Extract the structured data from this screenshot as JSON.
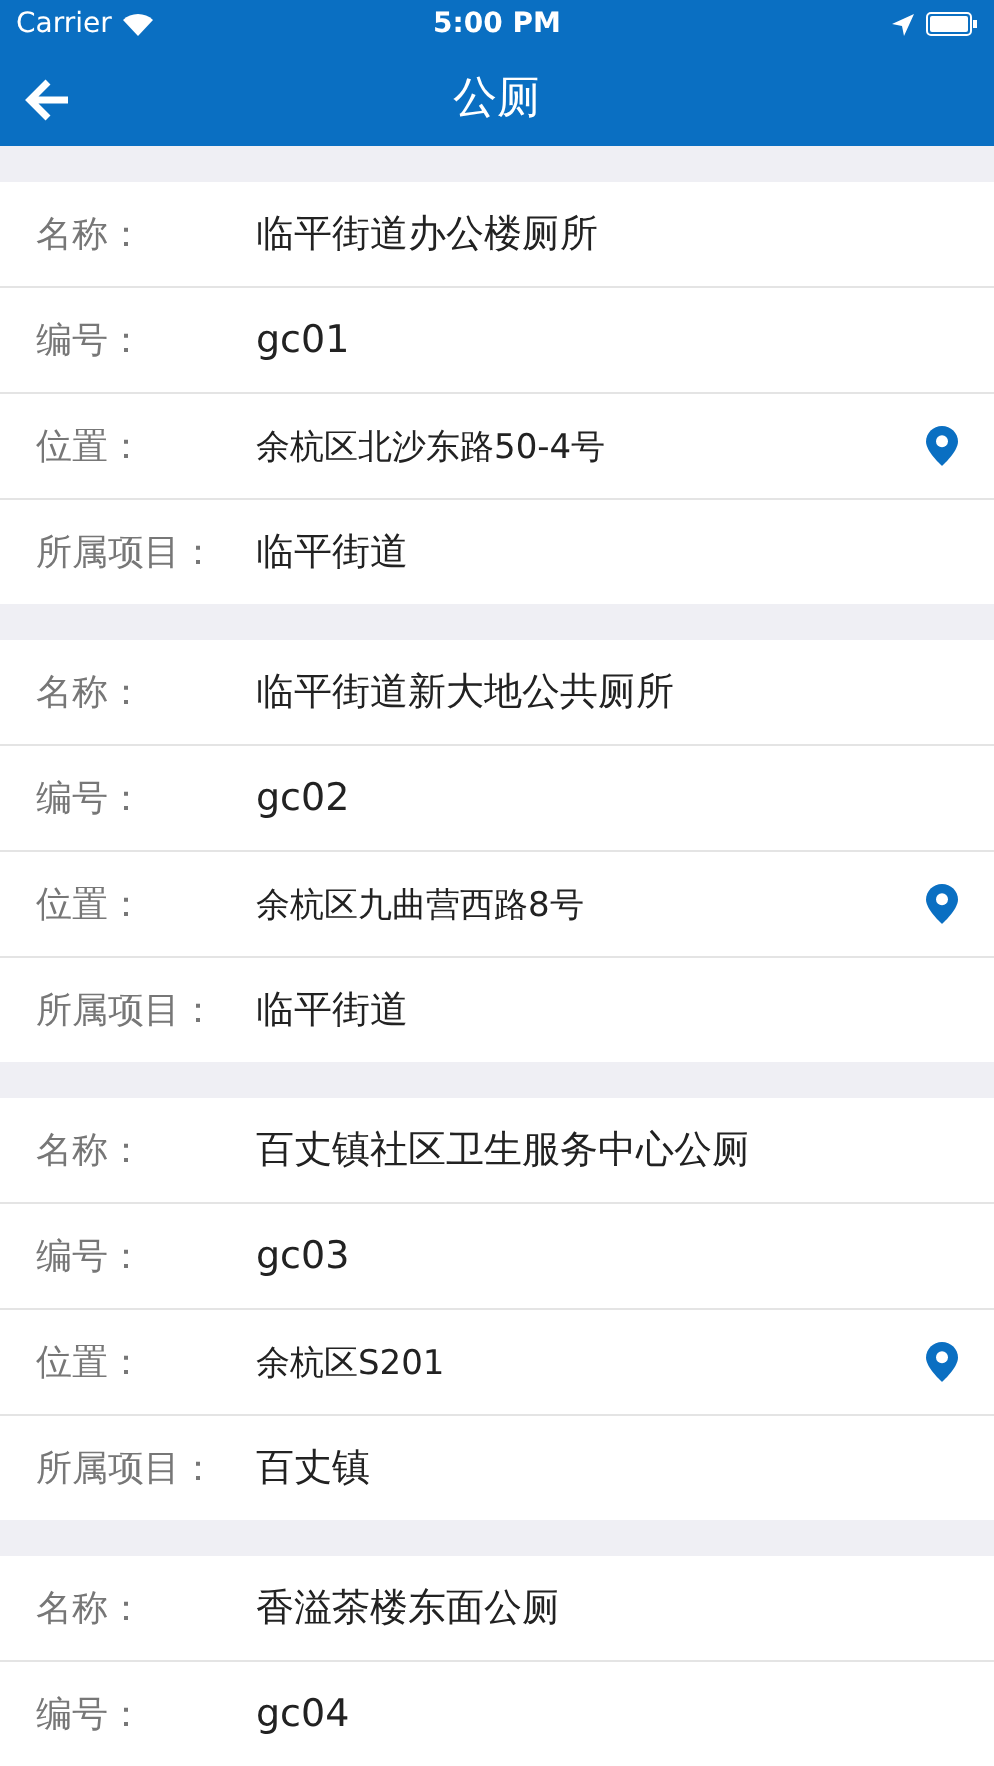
{
  "status_bar": {
    "carrier": "Carrier",
    "time": "5:00 PM"
  },
  "nav": {
    "title": "公厕"
  },
  "records": [
    {
      "fields": [
        {
          "kind": "text",
          "label": "名称：",
          "value": "临平街道办公楼厕所"
        },
        {
          "kind": "text",
          "label": "编号：",
          "value": "gc01"
        },
        {
          "kind": "location",
          "label": "位置：",
          "value": "余杭区北沙东路50-4号"
        },
        {
          "kind": "text",
          "label": "所属项目：",
          "value": "临平街道"
        }
      ]
    },
    {
      "fields": [
        {
          "kind": "text",
          "label": "名称：",
          "value": "临平街道新大地公共厕所"
        },
        {
          "kind": "text",
          "label": "编号：",
          "value": "gc02"
        },
        {
          "kind": "location",
          "label": "位置：",
          "value": "余杭区九曲营西路8号"
        },
        {
          "kind": "text",
          "label": "所属项目：",
          "value": "临平街道"
        }
      ]
    },
    {
      "fields": [
        {
          "kind": "text",
          "label": "名称：",
          "value": "百丈镇社区卫生服务中心公厕"
        },
        {
          "kind": "text",
          "label": "编号：",
          "value": "gc03"
        },
        {
          "kind": "location",
          "label": "位置：",
          "value": "余杭区S201"
        },
        {
          "kind": "text",
          "label": "所属项目：",
          "value": "百丈镇"
        }
      ]
    },
    {
      "fields": [
        {
          "kind": "text",
          "label": "名称：",
          "value": "香溢茶楼东面公厕"
        },
        {
          "kind": "text",
          "label": "编号：",
          "value": "gc04"
        }
      ]
    }
  ]
}
